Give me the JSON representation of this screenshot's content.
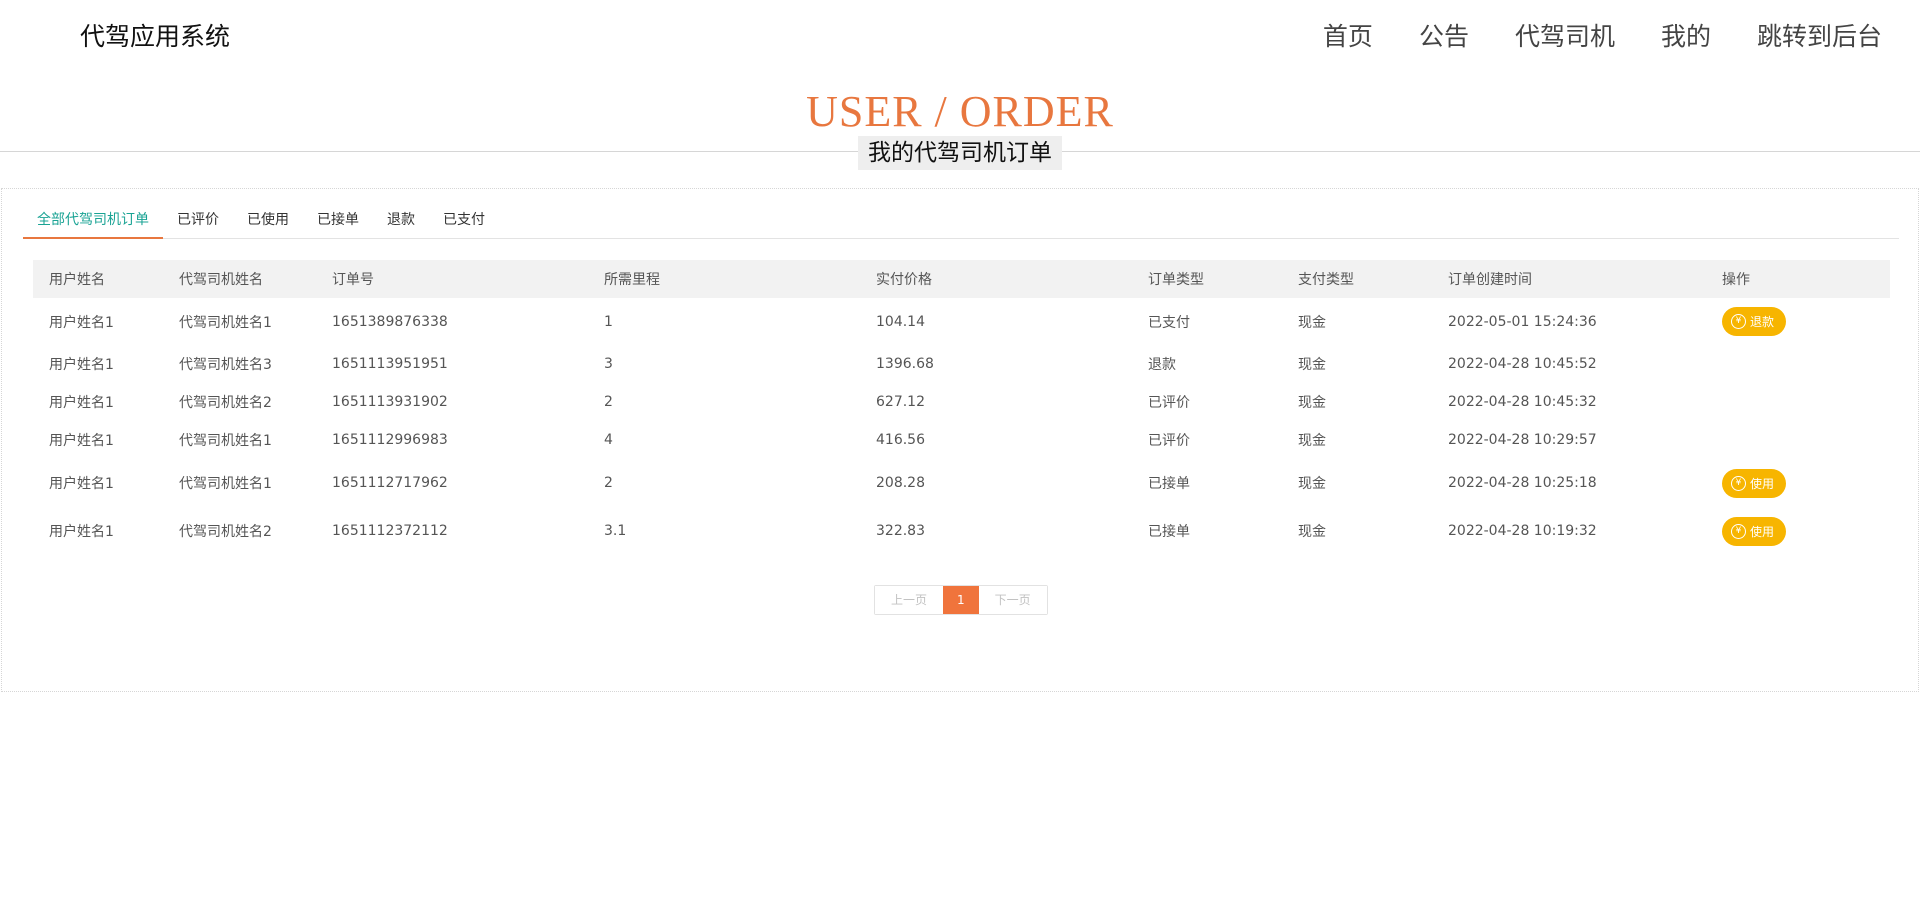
{
  "brand": "代驾应用系统",
  "nav": [
    "首页",
    "公告",
    "代驾司机",
    "我的",
    "跳转到后台"
  ],
  "hero": {
    "title": "USER / ORDER",
    "subtitle": "我的代驾司机订单"
  },
  "tabs": [
    "全部代驾司机订单",
    "已评价",
    "已使用",
    "已接单",
    "退款",
    "已支付"
  ],
  "table": {
    "headers": [
      "用户姓名",
      "代驾司机姓名",
      "订单号",
      "所需里程",
      "实付价格",
      "订单类型",
      "支付类型",
      "订单创建时间",
      "操作"
    ],
    "rows": [
      {
        "user": "用户姓名1",
        "driver": "代驾司机姓名1",
        "order_no": "1651389876338",
        "mileage": "1",
        "price": "104.14",
        "order_type": "已支付",
        "pay_type": "现金",
        "created": "2022-05-01 15:24:36",
        "action": "退款"
      },
      {
        "user": "用户姓名1",
        "driver": "代驾司机姓名3",
        "order_no": "1651113951951",
        "mileage": "3",
        "price": "1396.68",
        "order_type": "退款",
        "pay_type": "现金",
        "created": "2022-04-28 10:45:52",
        "action": ""
      },
      {
        "user": "用户姓名1",
        "driver": "代驾司机姓名2",
        "order_no": "1651113931902",
        "mileage": "2",
        "price": "627.12",
        "order_type": "已评价",
        "pay_type": "现金",
        "created": "2022-04-28 10:45:32",
        "action": ""
      },
      {
        "user": "用户姓名1",
        "driver": "代驾司机姓名1",
        "order_no": "1651112996983",
        "mileage": "4",
        "price": "416.56",
        "order_type": "已评价",
        "pay_type": "现金",
        "created": "2022-04-28 10:29:57",
        "action": ""
      },
      {
        "user": "用户姓名1",
        "driver": "代驾司机姓名1",
        "order_no": "1651112717962",
        "mileage": "2",
        "price": "208.28",
        "order_type": "已接单",
        "pay_type": "现金",
        "created": "2022-04-28 10:25:18",
        "action": "使用"
      },
      {
        "user": "用户姓名1",
        "driver": "代驾司机姓名2",
        "order_no": "1651112372112",
        "mileage": "3.1",
        "price": "322.83",
        "order_type": "已接单",
        "pay_type": "现金",
        "created": "2022-04-28 10:19:32",
        "action": "使用"
      }
    ]
  },
  "pagination": {
    "prev": "上一页",
    "current": "1",
    "next": "下一页"
  },
  "icons": {
    "action_icon": "yen-circle-icon",
    "action_glyph": "¥"
  },
  "colors": {
    "accent": "#e8773f",
    "tab_active": "#1aa394",
    "action_button": "#f7b500",
    "page_current": "#f0743c"
  }
}
